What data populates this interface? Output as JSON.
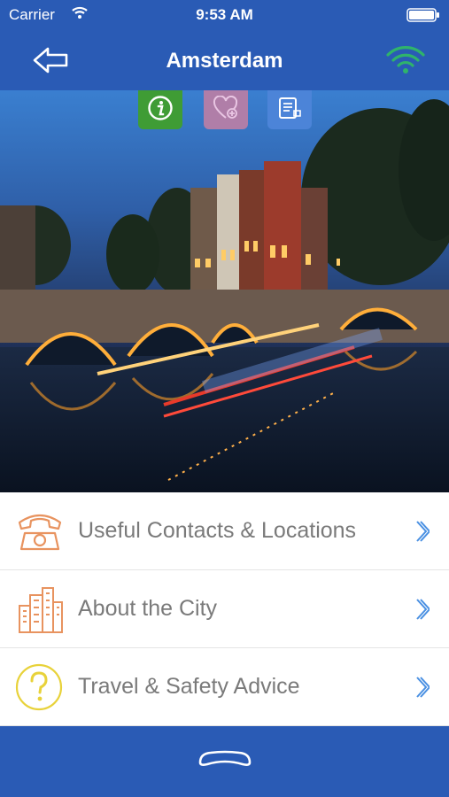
{
  "status_bar": {
    "carrier": "Carrier",
    "time": "9:53 AM"
  },
  "header": {
    "title": "Amsterdam",
    "back_icon": "back-arrow-icon",
    "status_icon": "wifi-icon"
  },
  "hero": {
    "actions": [
      {
        "icon": "info-icon",
        "color": "#3f9c35"
      },
      {
        "icon": "heart-plus-icon",
        "color": "#b07ea8"
      },
      {
        "icon": "notes-icon",
        "color": "#4c84d8"
      }
    ]
  },
  "menu": {
    "items": [
      {
        "label": "Useful Contacts & Locations",
        "icon": "telephone-icon",
        "icon_color": "#e8935f"
      },
      {
        "label": "About the City",
        "icon": "city-buildings-icon",
        "icon_color": "#e8935f"
      },
      {
        "label": "Travel & Safety Advice",
        "icon": "question-mark-icon",
        "icon_color": "#e8d23a"
      }
    ],
    "chevron_color": "#4a90e2"
  },
  "colors": {
    "bar": "#2a5bb5",
    "accent_green": "#2fb36b"
  }
}
